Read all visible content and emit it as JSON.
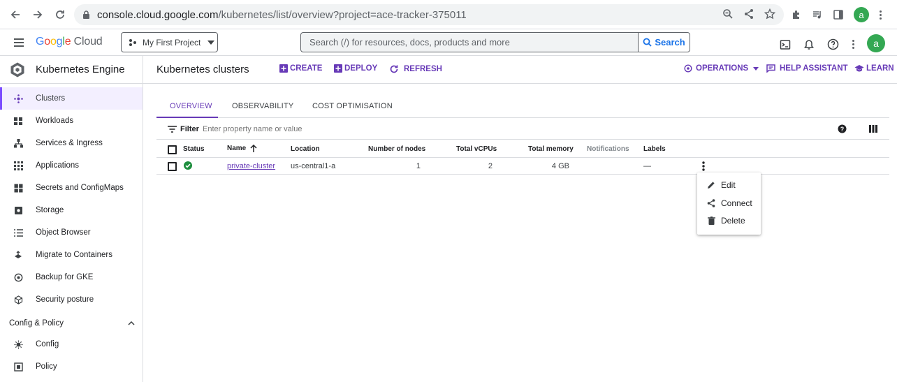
{
  "browser": {
    "url_host": "console.cloud.google.com",
    "url_path": "/kubernetes/list/overview?project=ace-tracker-375011",
    "avatar_letter": "a"
  },
  "header": {
    "logo_google": "Google",
    "logo_cloud": "Cloud",
    "project_name": "My First Project",
    "search_placeholder": "Search (/) for resources, docs, products and more",
    "search_button": "Search",
    "avatar_letter": "a"
  },
  "sidebar": {
    "title": "Kubernetes Engine",
    "items": [
      {
        "label": "Clusters",
        "icon": "clusters-icon"
      },
      {
        "label": "Workloads",
        "icon": "workloads-icon"
      },
      {
        "label": "Services & Ingress",
        "icon": "services-icon"
      },
      {
        "label": "Applications",
        "icon": "applications-icon"
      },
      {
        "label": "Secrets and ConfigMaps",
        "icon": "secrets-icon"
      },
      {
        "label": "Storage",
        "icon": "storage-icon"
      },
      {
        "label": "Object Browser",
        "icon": "object-browser-icon"
      },
      {
        "label": "Migrate to Containers",
        "icon": "migrate-icon"
      },
      {
        "label": "Backup for GKE",
        "icon": "backup-icon"
      },
      {
        "label": "Security posture",
        "icon": "security-posture-icon"
      }
    ],
    "section_label": "Config & Policy",
    "section_items": [
      {
        "label": "Config",
        "icon": "config-icon"
      },
      {
        "label": "Policy",
        "icon": "policy-icon"
      }
    ]
  },
  "action_bar": {
    "page_title": "Kubernetes clusters",
    "create": "CREATE",
    "deploy": "DEPLOY",
    "refresh": "REFRESH",
    "operations": "OPERATIONS",
    "help_assistant": "HELP ASSISTANT",
    "learn": "LEARN"
  },
  "tabs": [
    "OVERVIEW",
    "OBSERVABILITY",
    "COST OPTIMISATION"
  ],
  "filter": {
    "label": "Filter",
    "placeholder": "Enter property name or value"
  },
  "table": {
    "headers": {
      "status": "Status",
      "name": "Name",
      "location": "Location",
      "nodes": "Number of nodes",
      "vcpus": "Total vCPUs",
      "memory": "Total memory",
      "notifications": "Notifications",
      "labels": "Labels"
    },
    "rows": [
      {
        "name": "private-cluster",
        "location": "us-central1-a",
        "nodes": "1",
        "vcpus": "2",
        "memory": "4 GB",
        "notifications": "",
        "labels": "—"
      }
    ]
  },
  "context_menu": {
    "edit": "Edit",
    "connect": "Connect",
    "delete": "Delete"
  },
  "colors": {
    "accent": "#673ab7",
    "status_ok": "#1e8e3e",
    "link_blue": "#1a73e8"
  }
}
